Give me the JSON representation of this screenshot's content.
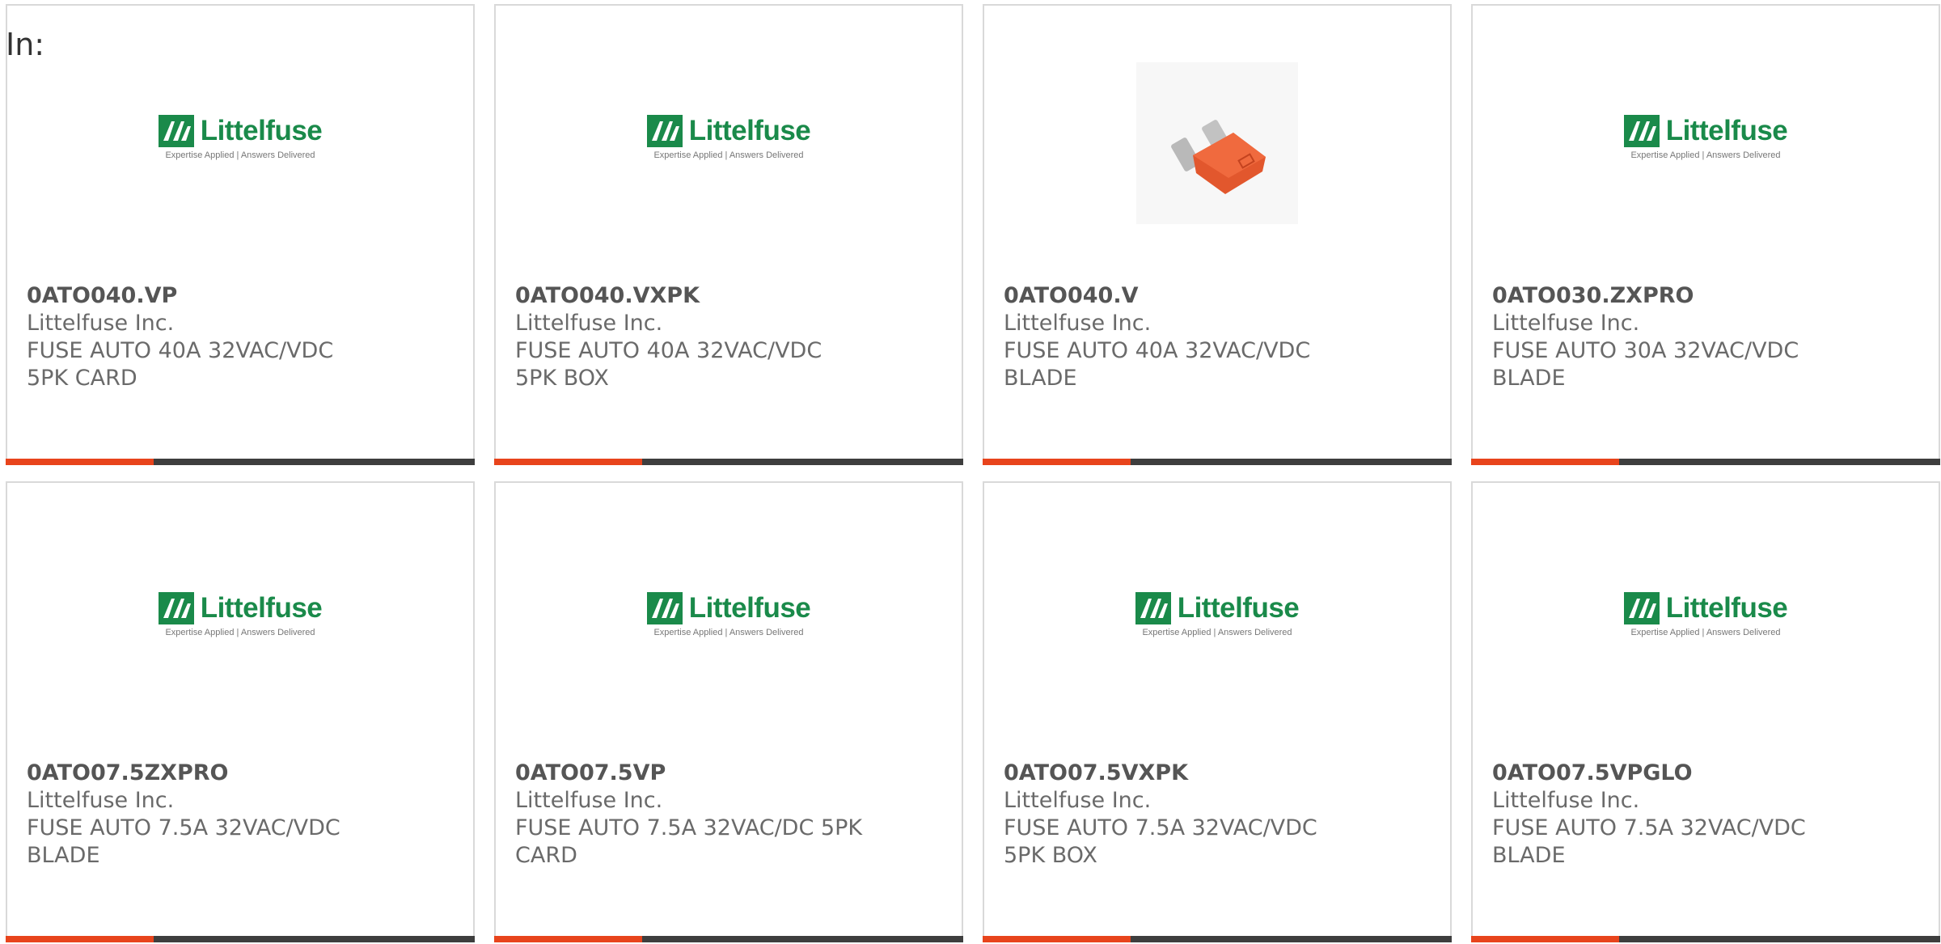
{
  "filter": {
    "label": "In:"
  },
  "brand": {
    "name": "Littelfuse",
    "tagline": "Expertise Applied | Answers Delivered",
    "primary_color": "#1a8a4a",
    "accent_color": "#e8441c",
    "bar_color": "#3e3e3e"
  },
  "products": [
    {
      "part_number": "0ATO040.VP",
      "manufacturer": "Littelfuse Inc.",
      "description": "FUSE AUTO 40A 32VAC/VDC 5PK CARD",
      "image": "littelfuse-logo"
    },
    {
      "part_number": "0ATO040.VXPK",
      "manufacturer": "Littelfuse Inc.",
      "description": "FUSE AUTO 40A 32VAC/VDC 5PK BOX",
      "image": "littelfuse-logo"
    },
    {
      "part_number": "0ATO040.V",
      "manufacturer": "Littelfuse Inc.",
      "description": "FUSE AUTO 40A 32VAC/VDC BLADE",
      "image": "blade-fuse-photo"
    },
    {
      "part_number": "0ATO030.ZXPRO",
      "manufacturer": "Littelfuse Inc.",
      "description": "FUSE AUTO 30A 32VAC/VDC BLADE",
      "image": "littelfuse-logo"
    },
    {
      "part_number": "0ATO07.5ZXPRO",
      "manufacturer": "Littelfuse Inc.",
      "description": "FUSE AUTO 7.5A 32VAC/VDC BLADE",
      "image": "littelfuse-logo"
    },
    {
      "part_number": "0ATO07.5VP",
      "manufacturer": "Littelfuse Inc.",
      "description": "FUSE AUTO 7.5A 32VAC/DC 5PK CARD",
      "image": "littelfuse-logo"
    },
    {
      "part_number": "0ATO07.5VXPK",
      "manufacturer": "Littelfuse Inc.",
      "description": "FUSE AUTO 7.5A 32VAC/VDC 5PK BOX",
      "image": "littelfuse-logo"
    },
    {
      "part_number": "0ATO07.5VPGLO",
      "manufacturer": "Littelfuse Inc.",
      "description": "FUSE AUTO 7.5A 32VAC/VDC BLADE",
      "image": "littelfuse-logo"
    }
  ]
}
